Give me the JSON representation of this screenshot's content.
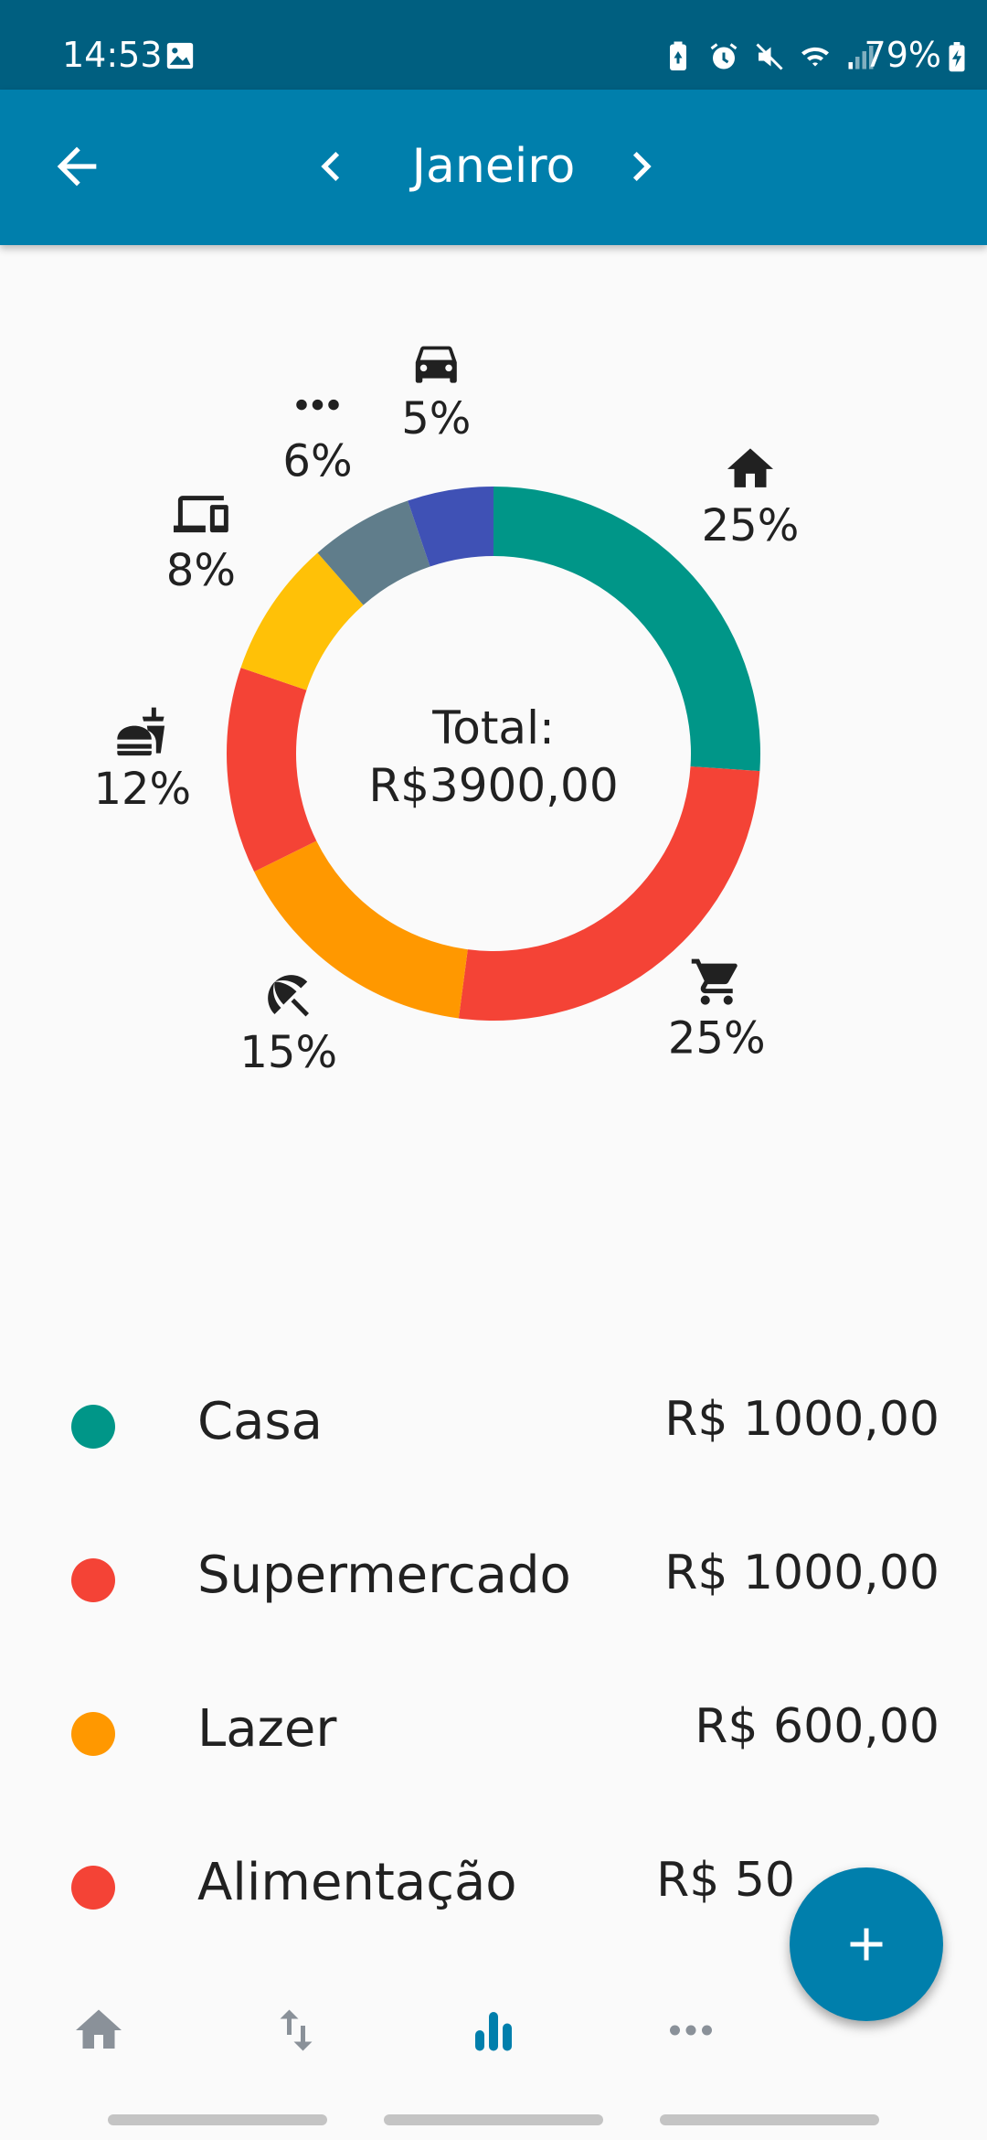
{
  "status_bar": {
    "time": "14:53",
    "battery": "79%",
    "icons": [
      "gallery-icon",
      "battery-saver-icon",
      "alarm-icon",
      "mute-icon",
      "wifi-icon",
      "signal-icon",
      "battery-charging-icon"
    ]
  },
  "app_bar": {
    "title": "Janeiro",
    "back_icon": "arrow-back-icon",
    "prev_icon": "chevron-left-icon",
    "next_icon": "chevron-right-icon"
  },
  "chart": {
    "center_label": "Total:",
    "center_value": "R$3900,00",
    "colors": {
      "casa": "#009688",
      "supermercado": "#f44336",
      "lazer": "#ff9800",
      "alimentacao": "#f44336",
      "eletronicos": "#ffc107",
      "outros": "#607d8b",
      "transporte": "#3f51b5"
    }
  },
  "chart_data": {
    "type": "pie",
    "title": "Total: R$3900,00",
    "slices": [
      {
        "category": "Casa",
        "icon": "home-icon",
        "value": 25,
        "label": "25%"
      },
      {
        "category": "Supermercado",
        "icon": "shopping-cart-icon",
        "value": 25,
        "label": "25%"
      },
      {
        "category": "Lazer",
        "icon": "beach-umbrella-icon",
        "value": 15,
        "label": "15%"
      },
      {
        "category": "Alimentação",
        "icon": "fastfood-icon",
        "value": 12,
        "label": "12%"
      },
      {
        "category": "Eletrônicos",
        "icon": "devices-icon",
        "value": 8,
        "label": "8%"
      },
      {
        "category": "Outros",
        "icon": "more-horiz-icon",
        "value": 6,
        "label": "6%"
      },
      {
        "category": "Transporte",
        "icon": "car-icon",
        "value": 5,
        "label": "5%"
      }
    ]
  },
  "legend": [
    {
      "name": "Casa",
      "amount": "R$ 1000,00",
      "color": "#009688"
    },
    {
      "name": "Supermercado",
      "amount": "R$ 1000,00",
      "color": "#f44336"
    },
    {
      "name": "Lazer",
      "amount": "R$ 600,00",
      "color": "#ff9800"
    },
    {
      "name": "Alimentação",
      "amount": "R$ 50",
      "color": "#f44336"
    }
  ],
  "bottom_nav": {
    "items": [
      {
        "icon": "home-icon",
        "active": false
      },
      {
        "icon": "swap-vertical-icon",
        "active": false
      },
      {
        "icon": "bar-chart-icon",
        "active": true
      },
      {
        "icon": "more-horiz-icon",
        "active": false
      }
    ],
    "active_color": "#007fac",
    "inactive_color": "#8a9199"
  },
  "fab": {
    "icon": "add-icon"
  }
}
